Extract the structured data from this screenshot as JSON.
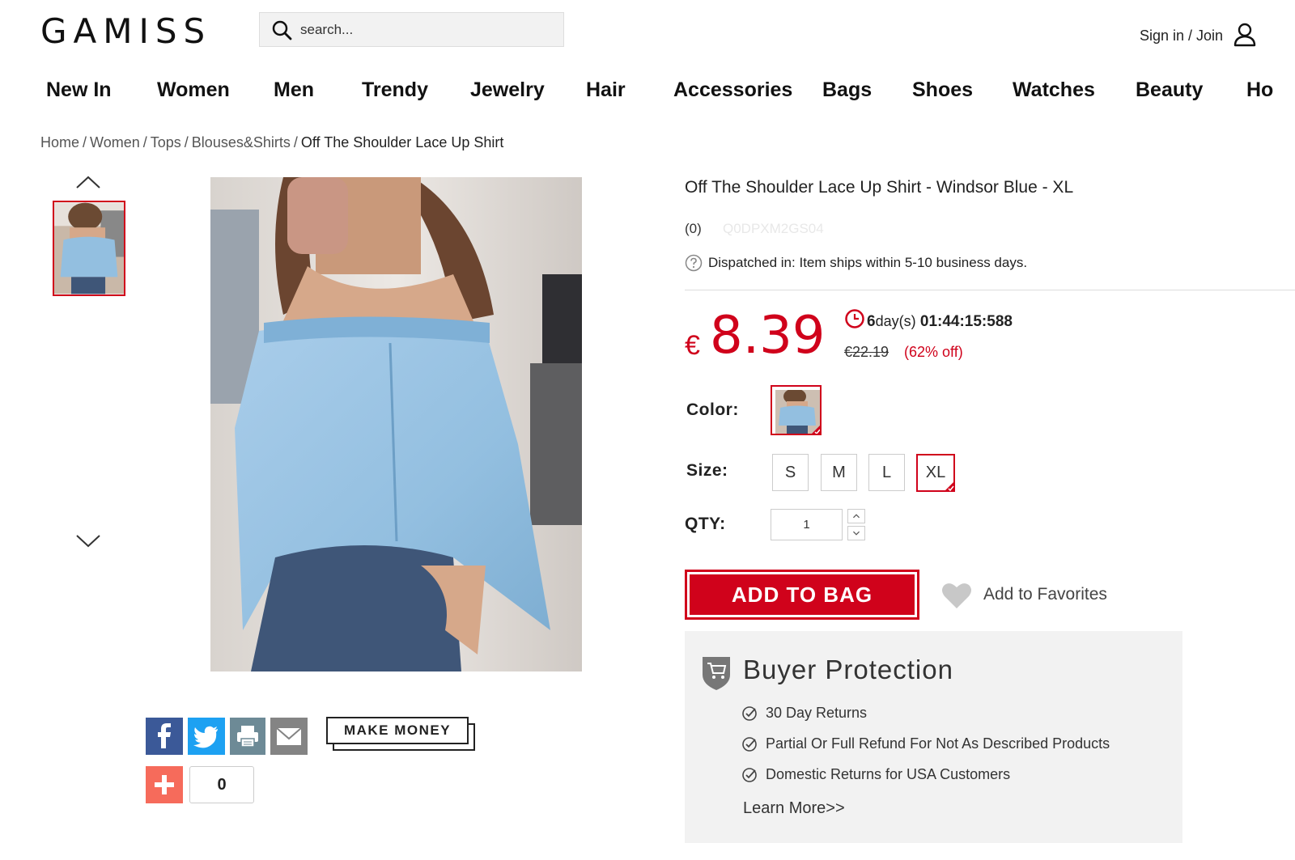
{
  "header": {
    "logo": "GAMISS",
    "search_placeholder": "search...",
    "signin_label": "Sign in / Join"
  },
  "nav": {
    "items": [
      "New In",
      "Women",
      "Men",
      "Trendy",
      "Jewelry",
      "Hair",
      "Accessories",
      "Bags",
      "Shoes",
      "Watches",
      "Beauty",
      "Ho"
    ]
  },
  "breadcrumb": {
    "items": [
      "Home",
      "Women",
      "Tops",
      "Blouses&Shirts"
    ],
    "current": "Off The Shoulder Lace Up Shirt",
    "separator": "/"
  },
  "product": {
    "title": "Off The Shoulder Lace Up Shirt - Windsor Blue - XL",
    "review_count": "(0)",
    "sku": "Q0DPXM2GS04",
    "dispatch_label": "Dispatched in:",
    "dispatch_text": "Item ships within 5-10 business days.",
    "currency": "€",
    "price": "8.39",
    "countdown_days": "6",
    "countdown_day_label": "day(s)",
    "countdown_time": "01:44:15:588",
    "original_price": "€22.19",
    "discount": "(62% off)",
    "color_label": "Color:",
    "size_label": "Size:",
    "sizes": [
      "S",
      "M",
      "L",
      "XL"
    ],
    "selected_size": "XL",
    "qty_label": "QTY:",
    "qty_value": "1",
    "add_to_bag": "ADD TO BAG",
    "add_to_favorites": "Add to Favorites"
  },
  "share": {
    "make_money": "MAKE MONEY",
    "plus_count": "0"
  },
  "buyer_protection": {
    "title": "Buyer Protection",
    "items": [
      "30 Day Returns",
      "Partial Or Full Refund For Not As Described Products",
      "Domestic Returns for USA Customers"
    ],
    "learn_more": "Learn More>>"
  },
  "colors": {
    "brand_red": "#d0021b",
    "facebook": "#3b5998",
    "twitter": "#1da1f2",
    "addthis": "#f66b5b",
    "shirt_blue": "#93bfe0"
  }
}
